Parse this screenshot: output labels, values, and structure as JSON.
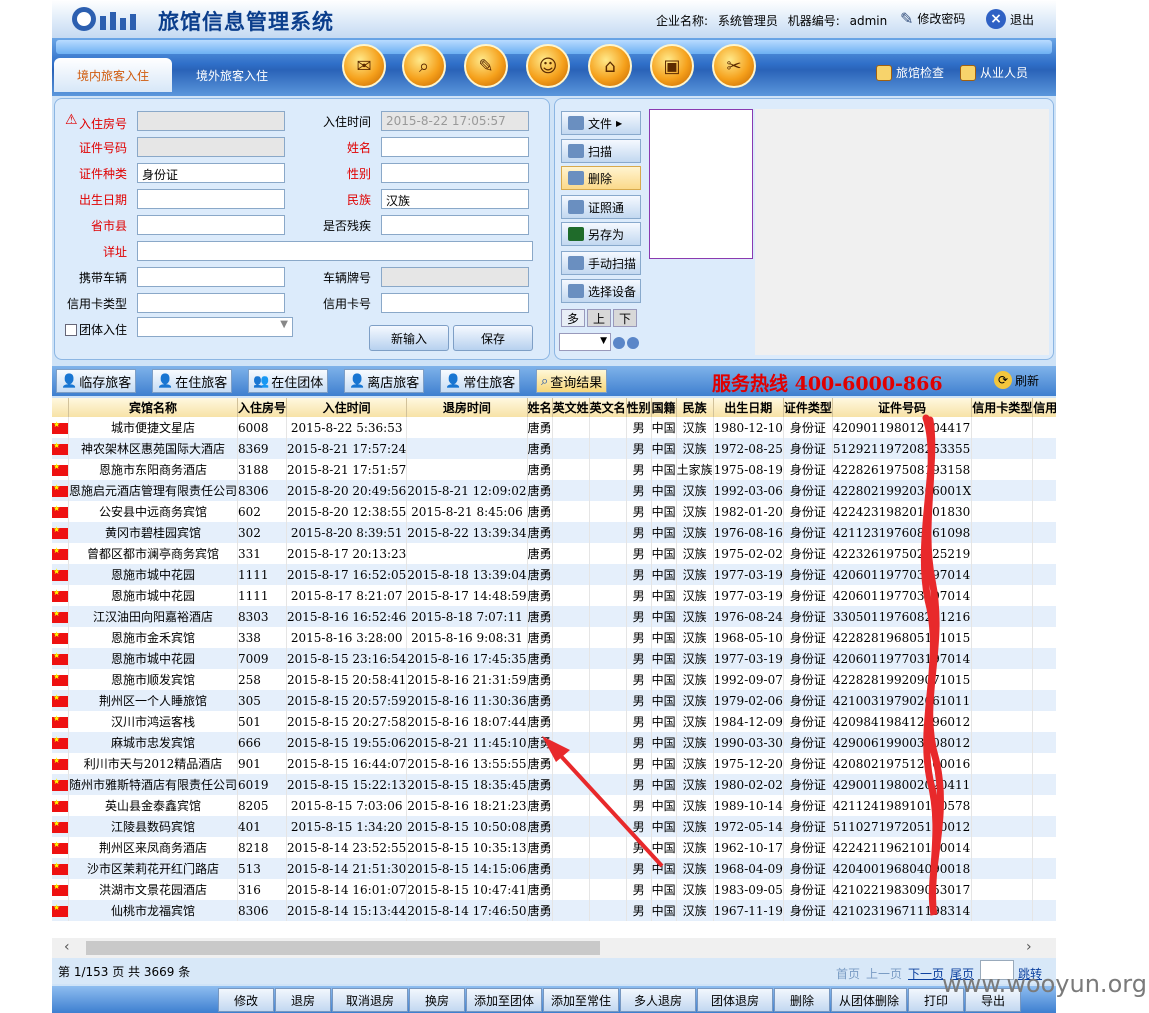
{
  "header": {
    "title": "旅馆信息管理系统",
    "company_label": "企业名称:",
    "company_value": "系统管理员",
    "machine_label": "机器编号:",
    "machine_value": "admin",
    "change_password": "修改密码",
    "logout": "退出"
  },
  "toolbar": {
    "tab_domestic": "境内旅客入住",
    "tab_foreign": "境外旅客入住",
    "inn_check": "旅馆检查",
    "staff": "从业人员"
  },
  "form": {
    "room_label": "入住房号",
    "checkin_time_label": "入住时间",
    "checkin_time_value": "2015-8-22 17:05:57",
    "id_no_label": "证件号码",
    "name_label": "姓名",
    "id_type_label": "证件种类",
    "id_type_value": "身份证",
    "gender_label": "性别",
    "birth_label": "出生日期",
    "ethnicity_label": "民族",
    "ethnicity_value": "汉族",
    "province_label": "省市县",
    "disabled_label": "是否残疾",
    "address_label": "详址",
    "vehicle_label": "携带车辆",
    "plate_label": "车辆牌号",
    "card_type_label": "信用卡类型",
    "card_no_label": "信用卡号",
    "group_label": "团体入住",
    "new_button": "新输入",
    "save_button": "保存"
  },
  "scanner": {
    "file": "文件",
    "scan": "扫描",
    "delete": "删除",
    "idpass": "证照通",
    "save_as": "另存为",
    "manual_scan": "手动扫描",
    "choose_device": "选择设备",
    "multi": "多",
    "up": "上",
    "down": "下"
  },
  "tabs": {
    "temp": "临存旅客",
    "staying": "在住旅客",
    "staying_group": "在住团体",
    "left": "离店旅客",
    "regular": "常住旅客",
    "query": "查询结果",
    "hotline": "服务热线 400-6000-866",
    "refresh": "刷新"
  },
  "table": {
    "columns": [
      "宾馆名称",
      "入住房号",
      "入住时间",
      "退房时间",
      "姓名",
      "英文姓",
      "英文名",
      "性别",
      "国籍",
      "民族",
      "出生日期",
      "证件类型",
      "证件号码",
      "信用卡类型",
      "信用卡"
    ],
    "rows": [
      [
        "城市便捷文星店",
        "6008",
        "2015-8-22 5:36:53",
        "",
        "唐勇",
        "",
        "",
        "男",
        "中国",
        "汉族",
        "1980-12-10",
        "身份证",
        "420901198012104417",
        "",
        ""
      ],
      [
        "神农架林区惠苑国际大酒店",
        "8369",
        "2015-8-21 17:57:24",
        "",
        "唐勇",
        "",
        "",
        "男",
        "中国",
        "汉族",
        "1972-08-25",
        "身份证",
        "512921197208253355",
        "",
        ""
      ],
      [
        "恩施市东阳商务酒店",
        "3188",
        "2015-8-21 17:51:57",
        "",
        "唐勇",
        "",
        "",
        "男",
        "中国",
        "土家族",
        "1975-08-19",
        "身份证",
        "422826197508193158",
        "",
        ""
      ],
      [
        "恩施启元酒店管理有限责任公司",
        "8306",
        "2015-8-20 20:49:56",
        "2015-8-21 12:09:02",
        "唐勇",
        "",
        "",
        "男",
        "中国",
        "汉族",
        "1992-03-06",
        "身份证",
        "42280219920306001X",
        "",
        ""
      ],
      [
        "公安县中远商务宾馆",
        "602",
        "2015-8-20 12:38:55",
        "2015-8-21 8:45:06",
        "唐勇",
        "",
        "",
        "男",
        "中国",
        "汉族",
        "1982-01-20",
        "身份证",
        "422423198201201830",
        "",
        ""
      ],
      [
        "黄冈市碧桂园宾馆",
        "302",
        "2015-8-20 8:39:51",
        "2015-8-22 13:39:34",
        "唐勇",
        "",
        "",
        "男",
        "中国",
        "汉族",
        "1976-08-16",
        "身份证",
        "421123197608161098",
        "",
        ""
      ],
      [
        "曾都区都市澜亭商务宾馆",
        "331",
        "2015-8-17 20:13:23",
        "",
        "唐勇",
        "",
        "",
        "男",
        "中国",
        "汉族",
        "1975-02-02",
        "身份证",
        "422326197502025219",
        "",
        ""
      ],
      [
        "恩施市城中花园",
        "1111",
        "2015-8-17 16:52:05",
        "2015-8-18 13:39:04",
        "唐勇",
        "",
        "",
        "男",
        "中国",
        "汉族",
        "1977-03-19",
        "身份证",
        "420601197703197014",
        "",
        ""
      ],
      [
        "恩施市城中花园",
        "1111",
        "2015-8-17 8:21:07",
        "2015-8-17 14:48:59",
        "唐勇",
        "",
        "",
        "男",
        "中国",
        "汉族",
        "1977-03-19",
        "身份证",
        "420601197703197014",
        "",
        ""
      ],
      [
        "江汉油田向阳嘉裕酒店",
        "8303",
        "2015-8-16 16:52:46",
        "2015-8-18 7:07:11",
        "唐勇",
        "",
        "",
        "男",
        "中国",
        "汉族",
        "1976-08-24",
        "身份证",
        "330501197608241216",
        "",
        ""
      ],
      [
        "恩施市金禾宾馆",
        "338",
        "2015-8-16 3:28:00",
        "2015-8-16 9:08:31",
        "唐勇",
        "",
        "",
        "男",
        "中国",
        "汉族",
        "1968-05-10",
        "身份证",
        "422828196805101015",
        "",
        ""
      ],
      [
        "恩施市城中花园",
        "7009",
        "2015-8-15 23:16:54",
        "2015-8-16 17:45:35",
        "唐勇",
        "",
        "",
        "男",
        "中国",
        "汉族",
        "1977-03-19",
        "身份证",
        "420601197703197014",
        "",
        ""
      ],
      [
        "恩施市顺发宾馆",
        "258",
        "2015-8-15 20:58:41",
        "2015-8-16 21:31:59",
        "唐勇",
        "",
        "",
        "男",
        "中国",
        "汉族",
        "1992-09-07",
        "身份证",
        "422828199209071015",
        "",
        ""
      ],
      [
        "荆州区一个人睡旅馆",
        "305",
        "2015-8-15 20:57:59",
        "2015-8-16 11:30:36",
        "唐勇",
        "",
        "",
        "男",
        "中国",
        "汉族",
        "1979-02-06",
        "身份证",
        "421003197902061011",
        "",
        ""
      ],
      [
        "汉川市鸿运客栈",
        "501",
        "2015-8-15 20:27:58",
        "2015-8-16 18:07:44",
        "唐勇",
        "",
        "",
        "男",
        "中国",
        "汉族",
        "1984-12-09",
        "身份证",
        "420984198412096012",
        "",
        ""
      ],
      [
        "麻城市忠发宾馆",
        "666",
        "2015-8-15 19:55:06",
        "2015-8-21 11:45:10",
        "唐勇",
        "",
        "",
        "男",
        "中国",
        "汉族",
        "1990-03-30",
        "身份证",
        "429006199003308012",
        "",
        ""
      ],
      [
        "利川市天与2012精品酒店",
        "901",
        "2015-8-15 16:44:07",
        "2015-8-16 13:55:55",
        "唐勇",
        "",
        "",
        "男",
        "中国",
        "汉族",
        "1975-12-20",
        "身份证",
        "420802197512200016",
        "",
        ""
      ],
      [
        "随州市雅斯特酒店有限责任公司",
        "6019",
        "2015-8-15 15:22:13",
        "2015-8-15 18:35:45",
        "唐勇",
        "",
        "",
        "男",
        "中国",
        "汉族",
        "1980-02-02",
        "身份证",
        "429001198002020411",
        "",
        ""
      ],
      [
        "英山县金泰鑫宾馆",
        "8205",
        "2015-8-15 7:03:06",
        "2015-8-16 18:21:23",
        "唐勇",
        "",
        "",
        "男",
        "中国",
        "汉族",
        "1989-10-14",
        "身份证",
        "421124198910140578",
        "",
        ""
      ],
      [
        "江陵县数码宾馆",
        "401",
        "2015-8-15 1:34:20",
        "2015-8-15 10:50:08",
        "唐勇",
        "",
        "",
        "男",
        "中国",
        "汉族",
        "1972-05-14",
        "身份证",
        "511027197205140012",
        "",
        ""
      ],
      [
        "荆州区来凤商务酒店",
        "8218",
        "2015-8-14 23:52:55",
        "2015-8-15 10:35:13",
        "唐勇",
        "",
        "",
        "男",
        "中国",
        "汉族",
        "1962-10-17",
        "身份证",
        "422421196210170014",
        "",
        ""
      ],
      [
        "沙市区茉莉花开红门路店",
        "513",
        "2015-8-14 21:51:30",
        "2015-8-15 14:15:06",
        "唐勇",
        "",
        "",
        "男",
        "中国",
        "汉族",
        "1968-04-09",
        "身份证",
        "420400196804090018",
        "",
        ""
      ],
      [
        "洪湖市文景花园酒店",
        "316",
        "2015-8-14 16:01:07",
        "2015-8-15 10:47:41",
        "唐勇",
        "",
        "",
        "男",
        "中国",
        "汉族",
        "1983-09-05",
        "身份证",
        "421022198309053017",
        "",
        ""
      ],
      [
        "仙桃市龙福宾馆",
        "8306",
        "2015-8-14 15:13:44",
        "2015-8-14 17:46:50",
        "唐勇",
        "",
        "",
        "男",
        "中国",
        "汉族",
        "1967-11-19",
        "身份证",
        "421023196711198314",
        "",
        ""
      ]
    ]
  },
  "pager": {
    "info": "第 1/153 页  共 3669 条",
    "first": "首页",
    "prev": "上一页",
    "next": "下一页",
    "last": "尾页",
    "jump": "跳转"
  },
  "bottom_actions": [
    "修改",
    "退房",
    "取消退房",
    "换房",
    "添加至团体",
    "添加至常住",
    "多人退房",
    "团体退房",
    "删除",
    "从团体删除",
    "打印",
    "导出"
  ],
  "watermark": "www.wooyun.org",
  "colors": {
    "accent": "#2f6fc8",
    "hotline": "#e00000",
    "annotation": "#e8292b"
  }
}
